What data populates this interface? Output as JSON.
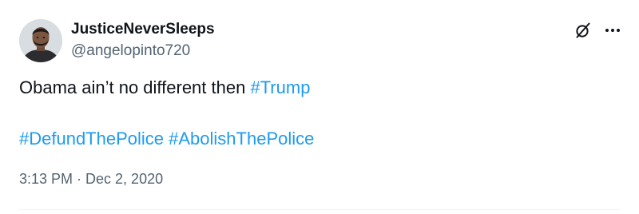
{
  "tweet": {
    "author": {
      "display_name": "JusticeNeverSleeps",
      "handle": "@angelopinto720"
    },
    "text": {
      "line1_prefix": "Obama ain’t no different then ",
      "hashtag_1": "#Trump",
      "hashtag_2": "#DefundThePolice",
      "hashtag_3": "#AbolishThePolice",
      "separator": " "
    },
    "timestamp": "3:13 PM · Dec 2, 2020",
    "icons": {
      "grok": "grok-icon",
      "more": "more-options-icon"
    }
  },
  "colors": {
    "text": "#0f1419",
    "secondary": "#536471",
    "link": "#1d9bf0",
    "divider": "#eff3f4"
  }
}
